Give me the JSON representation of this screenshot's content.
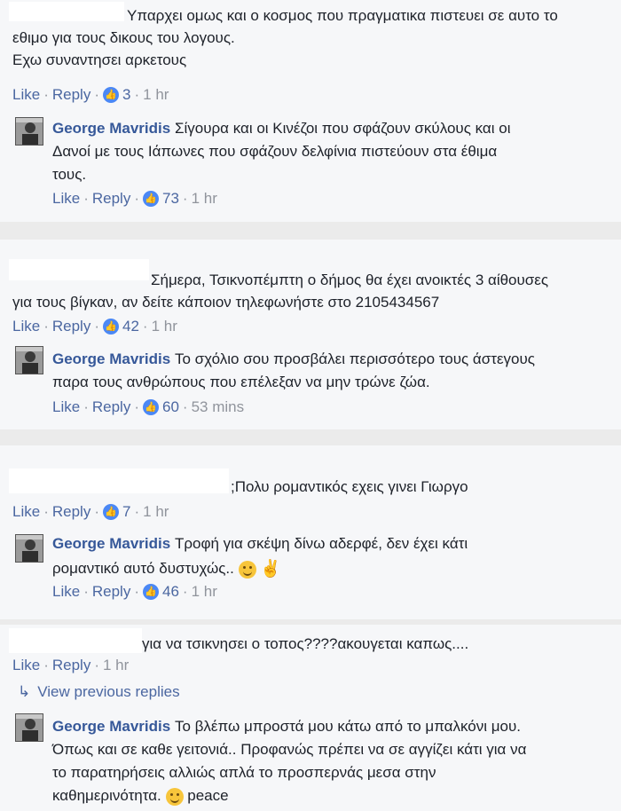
{
  "comments": [
    {
      "lines": [
        "Υπαρχει ομως και ο κοσμος που πραγματικα πιστευει σε αυτο το",
        "εθιμο για τους δικους του λογους.",
        "Εχω συναντησει αρκετους"
      ],
      "like": "Like",
      "reply": "Reply",
      "reactions": "3",
      "time": "1 hr"
    },
    {
      "author": "George Mavridis",
      "lines": [
        "Σίγουρα και οι Κινέζοι που σφάζουν σκύλους και οι",
        "Δανοί με τους Ιάπωνες που σφάζουν δελφίνια πιστεύουν στα έθιμα",
        "τους."
      ],
      "like": "Like",
      "reply": "Reply",
      "reactions": "73",
      "time": "1 hr"
    },
    {
      "lines": [
        "Σήμερα, Τσικνοπέμπτη ο δήμος θα έχει ανοικτές 3 αίθουσες",
        "για τους βίγκαν, αν δείτε κάποιον τηλεφωνήστε στο 2105434567"
      ],
      "like": "Like",
      "reply": "Reply",
      "reactions": "42",
      "time": "1 hr"
    },
    {
      "author": "George Mavridis",
      "lines": [
        "Το σχόλιο σου προσβάλει περισσότερο τους άστεγους",
        "παρα τους ανθρώπους που επέλεξαν να μην τρώνε ζώα."
      ],
      "like": "Like",
      "reply": "Reply",
      "reactions": "60",
      "time": "53 mins"
    },
    {
      "lines": [
        ";Πολυ ρομαντικός εχεις γινει Γιωργο"
      ],
      "like": "Like",
      "reply": "Reply",
      "reactions": "7",
      "time": "1 hr"
    },
    {
      "author": "George Mavridis",
      "lines": [
        "Τροφή για σκέψη δίνω αδερφέ, δεν έχει κάτι",
        "ρομαντικό αυτό δυστυχώς.."
      ],
      "like": "Like",
      "reply": "Reply",
      "reactions": "46",
      "time": "1 hr"
    },
    {
      "lines": [
        "για να τσικνησει ο τοπος????ακουγεται καπως...."
      ],
      "like": "Like",
      "reply": "Reply",
      "time": "1 hr"
    },
    {
      "author": "George Mavridis",
      "lines": [
        "Το βλέπω μπροστά μου κάτω από το μπαλκόνι μου.",
        "Όπως και σε καθε γειτονιά.. Προφανώς πρέπει να σε αγγίζει κάτι για να",
        "το παρατηρήσεις αλλιώς απλά το προσπερνάς μεσα στην",
        "καθημερινότητα."
      ],
      "trailing": "peace"
    }
  ],
  "view_previous": "View previous replies",
  "icons": {
    "reaction": "like-reaction-icon",
    "smile": "smile-emoji-icon",
    "victory": "victory-hand-emoji-icon",
    "reply_arrow": "reply-arrow-icon",
    "avatar": "avatar-photo"
  },
  "colors": {
    "link": "#365899",
    "meta": "#90949c",
    "reaction": "#4b88f5",
    "panel": "#f6f7f9",
    "divider": "#ebebeb"
  }
}
